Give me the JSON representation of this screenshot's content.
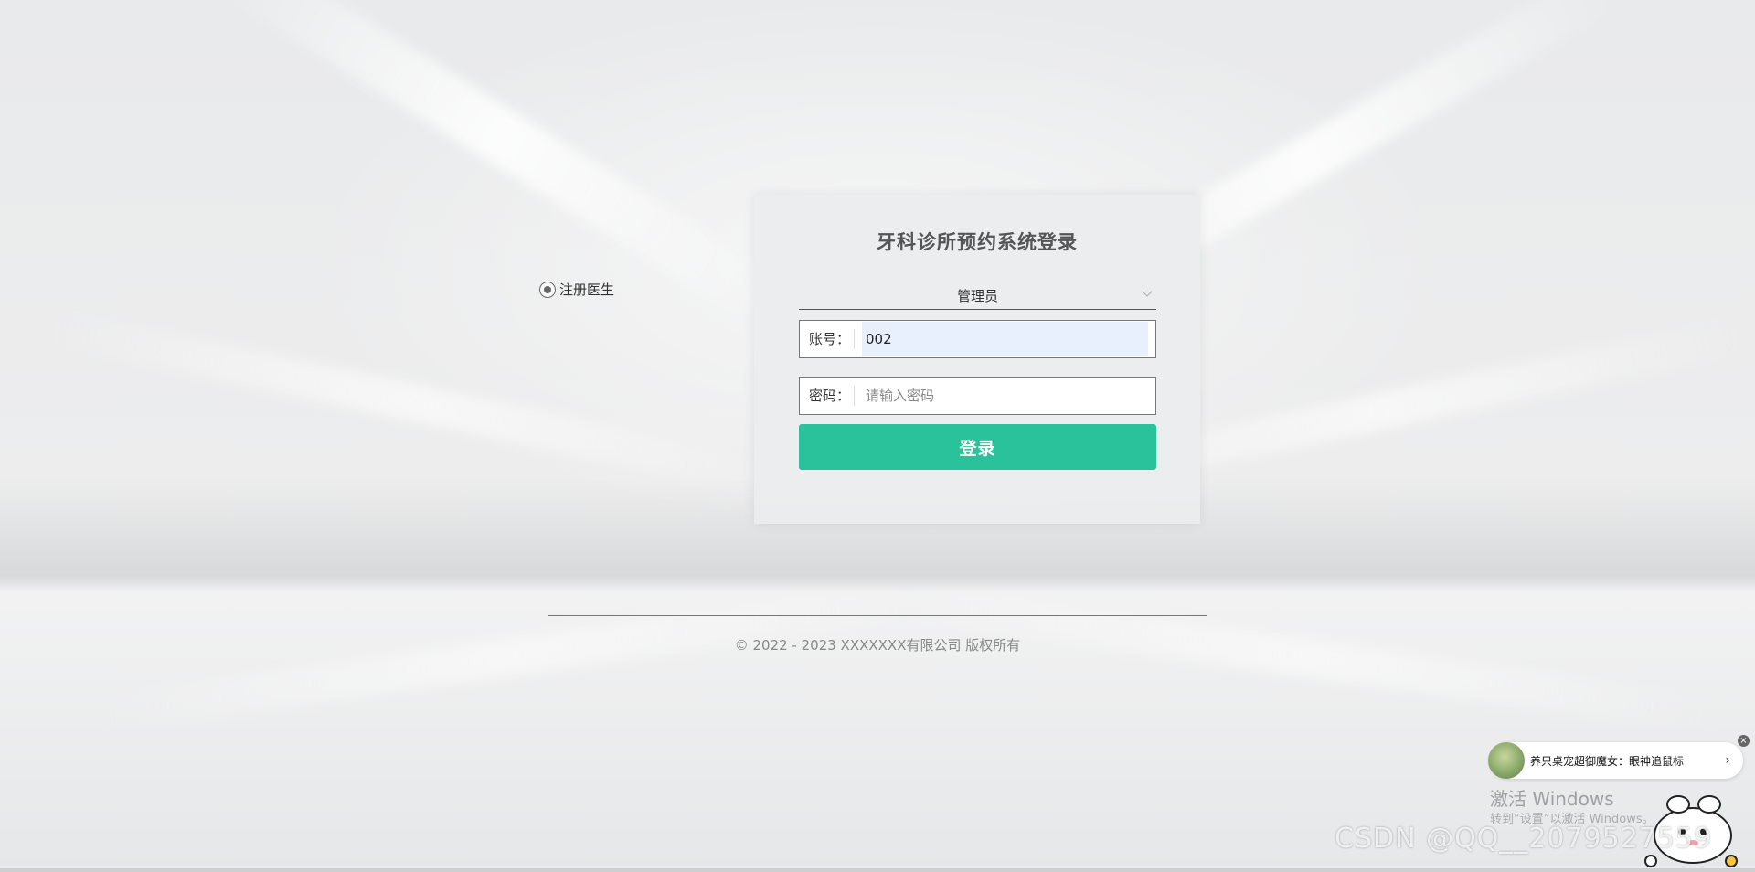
{
  "register": {
    "label": "注册医生"
  },
  "login": {
    "title": "牙科诊所预约系统登录",
    "role_select": {
      "selected": "管理员"
    },
    "account": {
      "label": "账号：",
      "value": "002"
    },
    "password": {
      "label": "密码：",
      "placeholder": "请输入密码",
      "value": ""
    },
    "submit_label": "登录"
  },
  "footer": {
    "copyright": "© 2022 - 2023 XXXXXXX有限公司 版权所有"
  },
  "overlay": {
    "pet_popup_text": "养只桌宠超御魔女：眼神追鼠标",
    "pet_popup_arrow": "›",
    "close_glyph": "×",
    "activate_title": "激活 Windows",
    "activate_sub": "转到“设置”以激活 Windows。",
    "watermark": "CSDN @QQ__2079527559"
  },
  "colors": {
    "accent": "#2ac29b",
    "account_autofill_bg": "#e8f0fe"
  },
  "icons": {
    "register_radio": "radio-selected-icon",
    "role_dropdown": "chevron-down-icon",
    "popup_close": "close-icon"
  }
}
